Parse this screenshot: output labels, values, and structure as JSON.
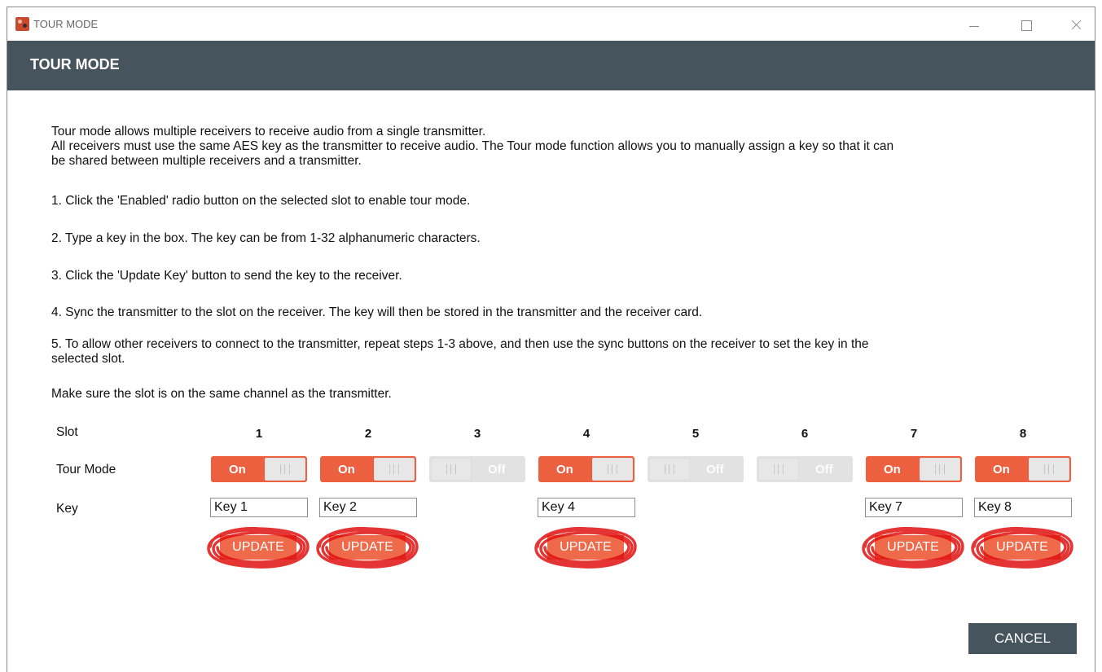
{
  "window": {
    "title": "TOUR MODE",
    "icon": "app-logo-icon"
  },
  "header": {
    "title": "TOUR MODE"
  },
  "description": {
    "intro_1": "Tour mode allows multiple receivers to receive audio from a single transmitter.",
    "intro_2": "All receivers must use the same AES key as the transmitter to receive audio. The Tour mode function allows you to manually assign a key so that it can",
    "intro_3": "be shared between multiple receivers and a transmitter.",
    "step_1": "1. Click the 'Enabled' radio button on the selected slot to enable tour mode.",
    "step_2": "2. Type a key in the box. The key can be from 1-32 alphanumeric characters.",
    "step_3": "3. Click the 'Update Key' button to send the key to the receiver.",
    "step_4": "4. Sync the transmitter to the slot on the receiver. The key will then be stored in the transmitter and the receiver card.",
    "step_5a": "5. To allow other receivers to connect to the transmitter, repeat steps 1-3 above, and then use the sync buttons on the receiver to set the key in the",
    "step_5b": "selected slot.",
    "note": "Make sure the slot is on the same channel as the transmitter."
  },
  "table": {
    "slot_label": "Slot",
    "tour_mode_label": "Tour Mode",
    "key_label": "Key",
    "slots": [
      {
        "number": "1",
        "toggle": "On",
        "state": "on",
        "key": "Key 1",
        "update": "UPDATE"
      },
      {
        "number": "2",
        "toggle": "On",
        "state": "on",
        "key": "Key 2",
        "update": "UPDATE"
      },
      {
        "number": "3",
        "toggle": "Off",
        "state": "off"
      },
      {
        "number": "4",
        "toggle": "On",
        "state": "on",
        "key": "Key 4",
        "update": "UPDATE"
      },
      {
        "number": "5",
        "toggle": "Off",
        "state": "off"
      },
      {
        "number": "6",
        "toggle": "Off",
        "state": "off"
      },
      {
        "number": "7",
        "toggle": "On",
        "state": "on",
        "key": "Key 7",
        "update": "UPDATE"
      },
      {
        "number": "8",
        "toggle": "On",
        "state": "on",
        "key": "Key 8",
        "update": "UPDATE"
      }
    ]
  },
  "footer": {
    "cancel_label": "CANCEL"
  },
  "colors": {
    "header_bg": "#46545d",
    "accent": "#ec5f3f",
    "annotation": "#e01010"
  }
}
